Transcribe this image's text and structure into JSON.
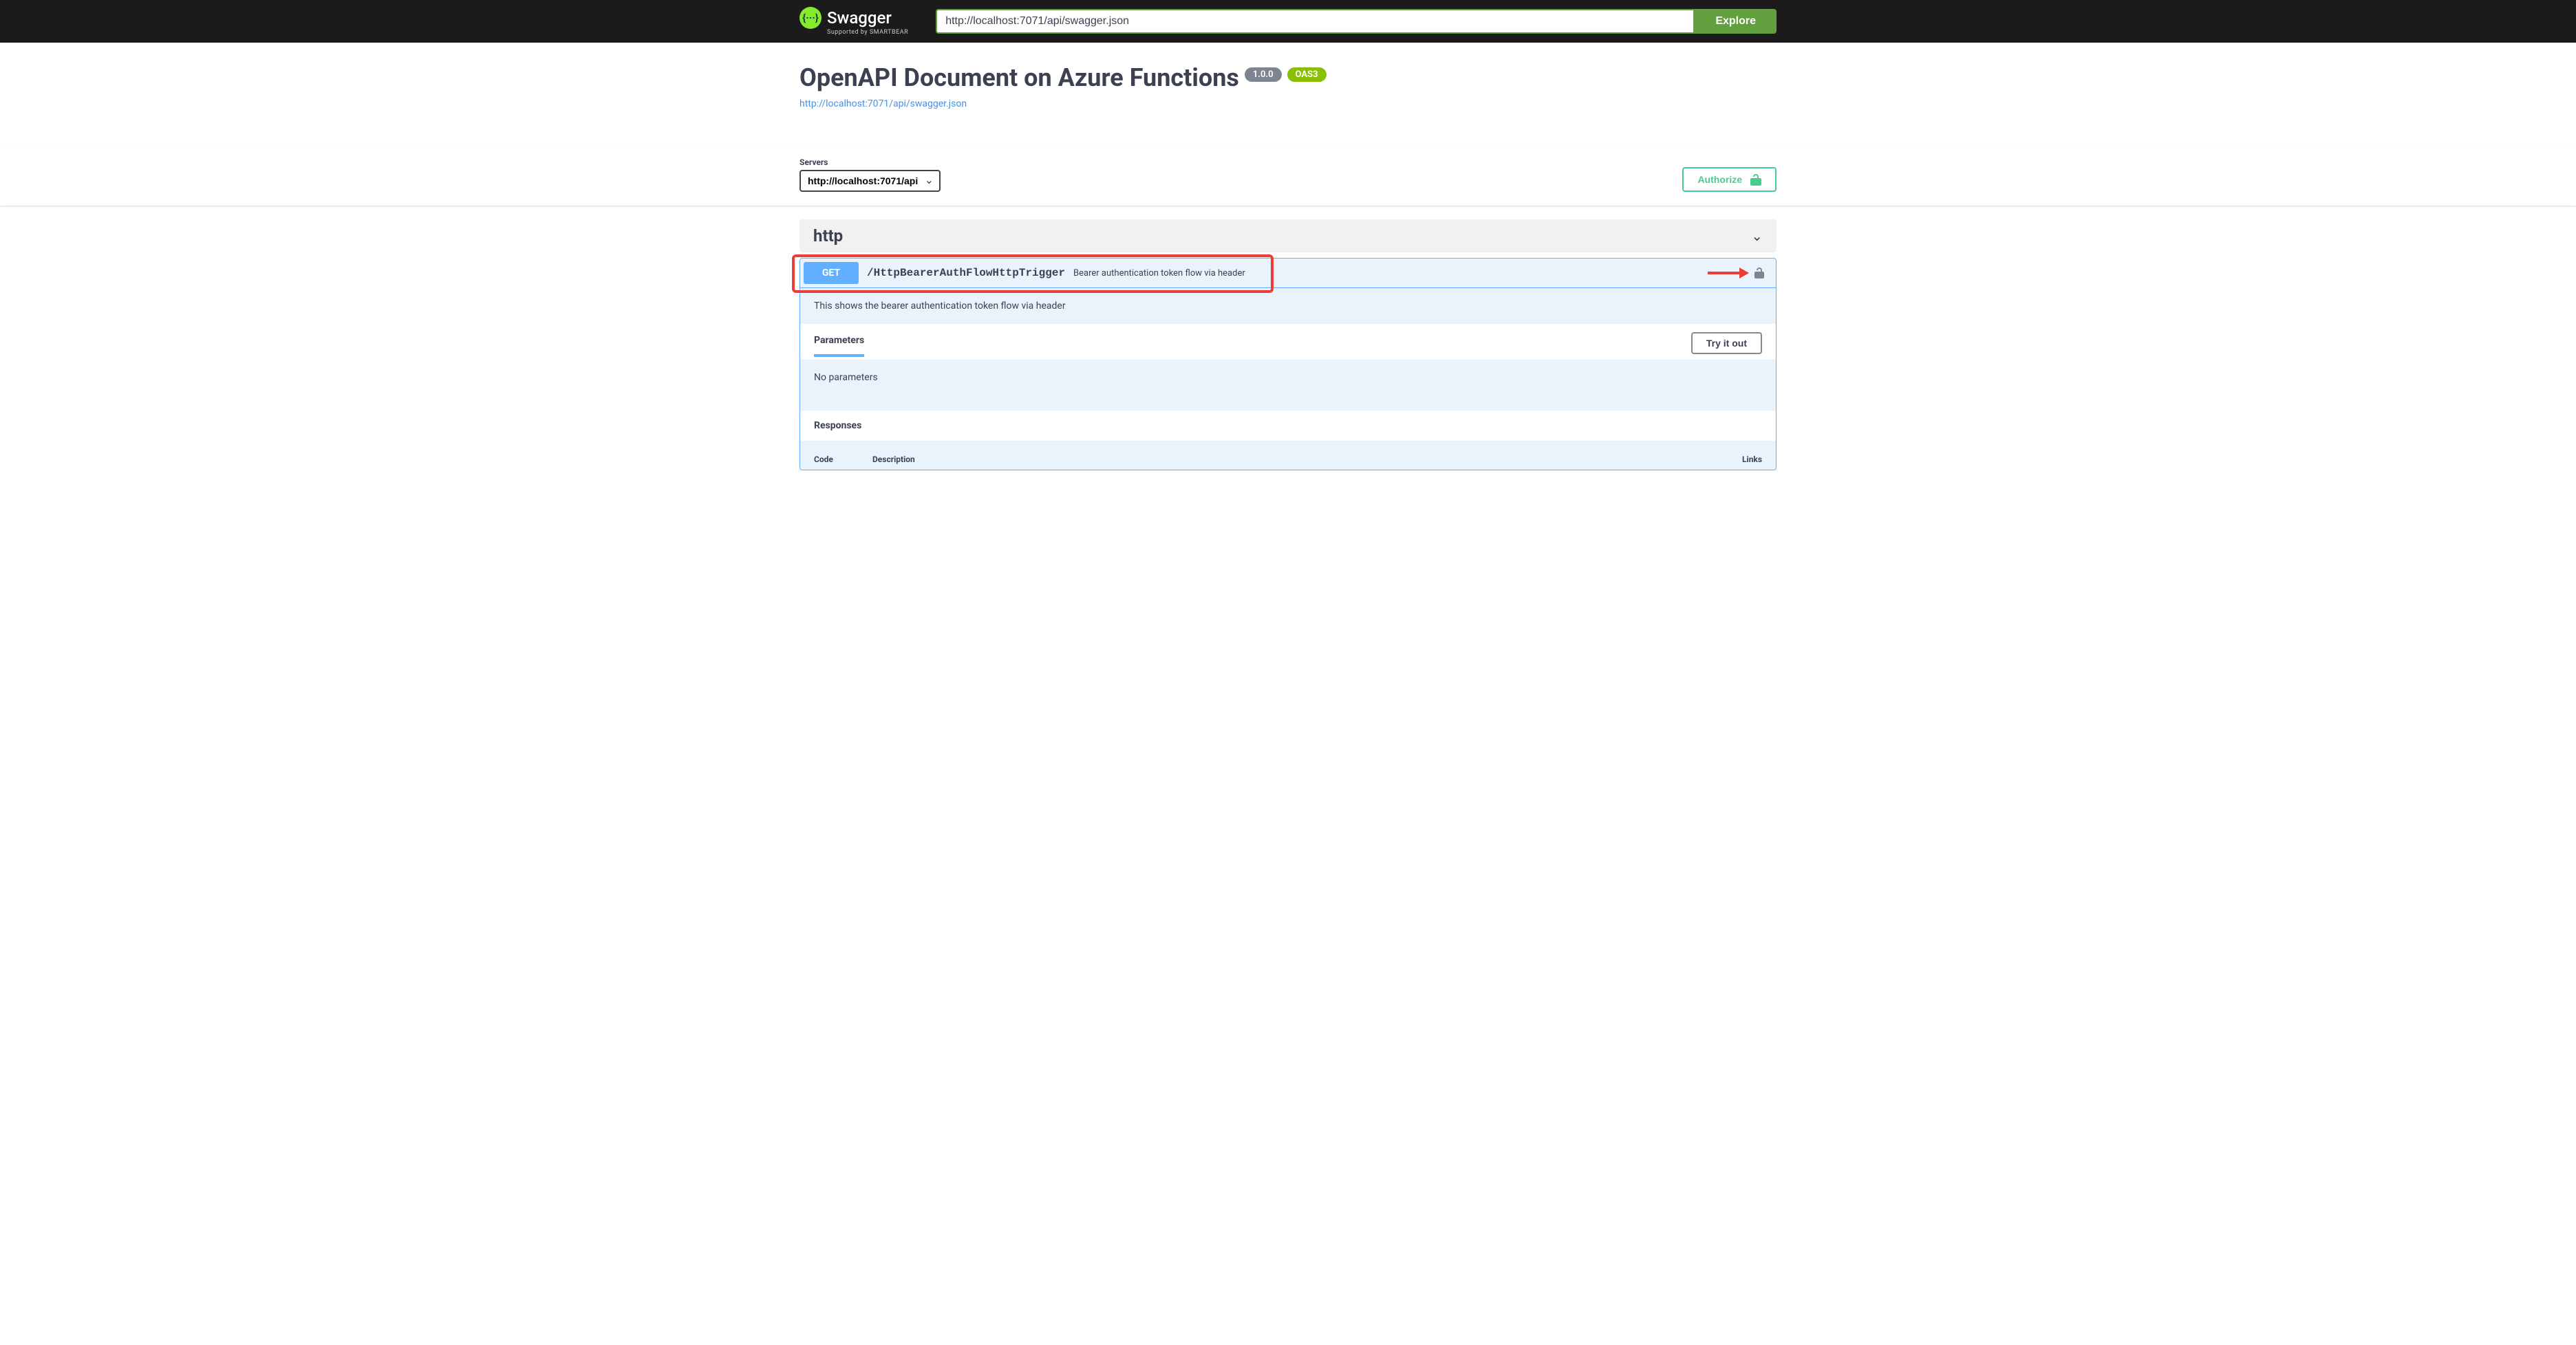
{
  "topbar": {
    "logo_glyph": "{···}",
    "logo_text": "Swagger",
    "logo_byline": "Supported by SMARTBEAR",
    "url_value": "http://localhost:7071/api/swagger.json",
    "explore_label": "Explore"
  },
  "info": {
    "title": "OpenAPI Document on Azure Functions",
    "version": "1.0.0",
    "oas_version": "OAS3",
    "spec_url": "http://localhost:7071/api/swagger.json"
  },
  "scheme": {
    "servers_label": "Servers",
    "server_value": "http://localhost:7071/api",
    "authorize_label": "Authorize"
  },
  "tag": {
    "name": "http"
  },
  "operation": {
    "method": "GET",
    "path": "/HttpBearerAuthFlowHttpTrigger",
    "summary": "Bearer authentication token flow via header",
    "description": "This shows the bearer authentication token flow via header",
    "parameters_label": "Parameters",
    "try_it_label": "Try it out",
    "no_params_text": "No parameters",
    "responses_label": "Responses",
    "col_code": "Code",
    "col_description": "Description",
    "col_links": "Links"
  }
}
